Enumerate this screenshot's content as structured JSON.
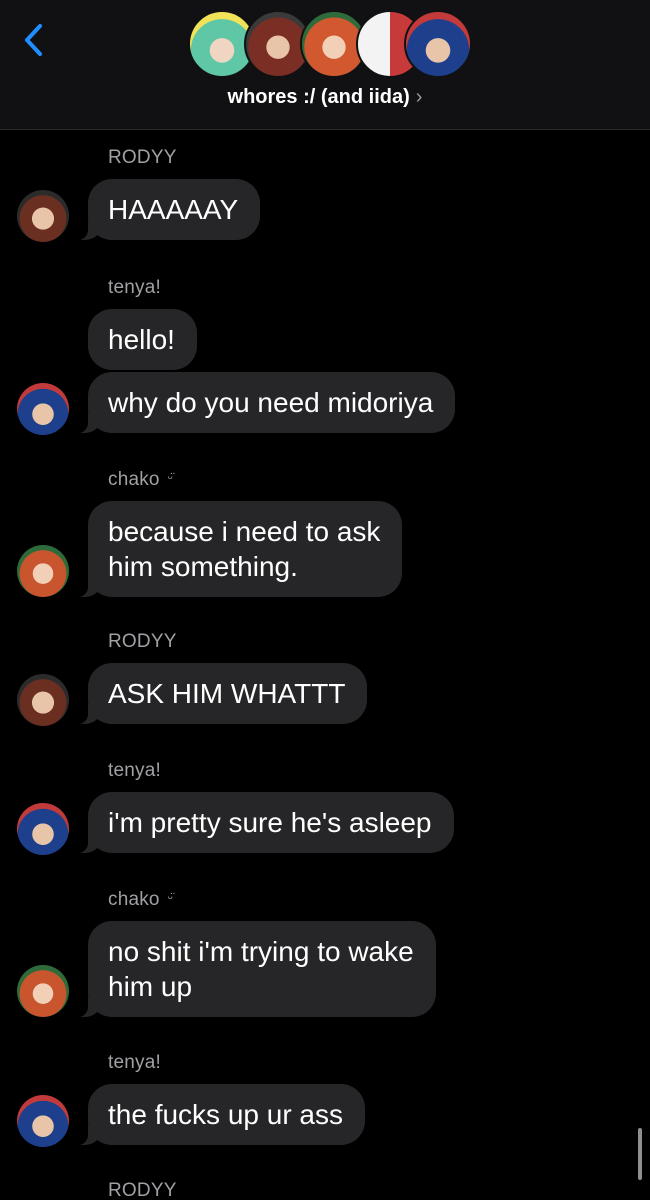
{
  "header": {
    "title": "whores :/ (and iida)",
    "chevron": "›",
    "back_icon": "chevron-left-icon",
    "accent": "#1f8fff",
    "member_avatars": [
      "avatar-green-hair",
      "avatar-red-hair",
      "avatar-orange-hair",
      "avatar-red-white-hair",
      "avatar-blue-hair"
    ]
  },
  "messages": [
    {
      "sender": "RODYY",
      "text": "HAAAAAY"
    },
    {
      "sender": "tenya!",
      "text": "hello!"
    },
    {
      "sender": "tenya!",
      "text": "why do you need midoriya"
    },
    {
      "sender": "chako",
      "sender_suffix": "ᵕ̈",
      "text": "because i need to ask"
    },
    {
      "sender": "chako",
      "text": "him something."
    },
    {
      "sender": "RODYY",
      "text": "ASK HIM WHATTT"
    },
    {
      "sender": "tenya!",
      "text": "i'm pretty sure he's asleep"
    },
    {
      "sender": "chako",
      "sender_suffix": "ᵕ̈",
      "text": "no shit i'm trying to wake"
    },
    {
      "sender": "chako",
      "text": "him up"
    },
    {
      "sender": "tenya!",
      "text": "the fucks up ur ass"
    },
    {
      "sender": "RODYY",
      "text": ""
    }
  ],
  "colors": {
    "bubble": "#262628",
    "background": "#000000",
    "name_label": "#a0a0a5"
  }
}
